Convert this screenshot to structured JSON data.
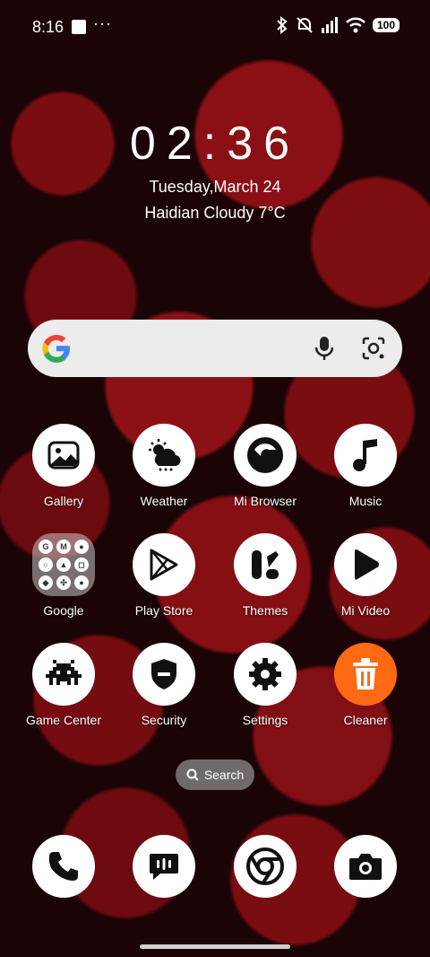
{
  "status_bar": {
    "time": "8:16",
    "more": "···",
    "battery": "100",
    "icons": [
      "bluetooth-icon",
      "mute-icon",
      "signal-icon",
      "wifi-icon",
      "battery-icon"
    ]
  },
  "clock": {
    "time": "02:36",
    "date": "Tuesday,March 24",
    "weather": "Haidian Cloudy 7°C"
  },
  "search_widget": {
    "icons": [
      "google-logo",
      "mic-icon",
      "lens-icon"
    ]
  },
  "apps": [
    {
      "label": "Gallery",
      "icon": "gallery-icon"
    },
    {
      "label": "Weather",
      "icon": "weather-icon"
    },
    {
      "label": "Mi Browser",
      "icon": "browser-icon"
    },
    {
      "label": "Music",
      "icon": "music-icon"
    },
    {
      "label": "Google",
      "icon": "google-folder"
    },
    {
      "label": "Play Store",
      "icon": "play-store-icon"
    },
    {
      "label": "Themes",
      "icon": "themes-icon"
    },
    {
      "label": "Mi Video",
      "icon": "video-icon"
    },
    {
      "label": "Game Center",
      "icon": "game-icon"
    },
    {
      "label": "Security",
      "icon": "security-icon"
    },
    {
      "label": "Settings",
      "icon": "settings-icon"
    },
    {
      "label": "Cleaner",
      "icon": "cleaner-icon"
    }
  ],
  "folder_items": [
    "G",
    "M",
    "●",
    "○",
    "▲",
    "◻",
    "◆",
    "✣",
    "●"
  ],
  "search_pill": {
    "label": "Search"
  },
  "dock": [
    "phone-icon",
    "messages-icon",
    "chrome-icon",
    "camera-icon"
  ],
  "colors": {
    "cleaner": "#ff6a13",
    "google_blue": "#4285F4",
    "google_red": "#EA4335",
    "google_yellow": "#FBBC05",
    "google_green": "#34A853"
  }
}
